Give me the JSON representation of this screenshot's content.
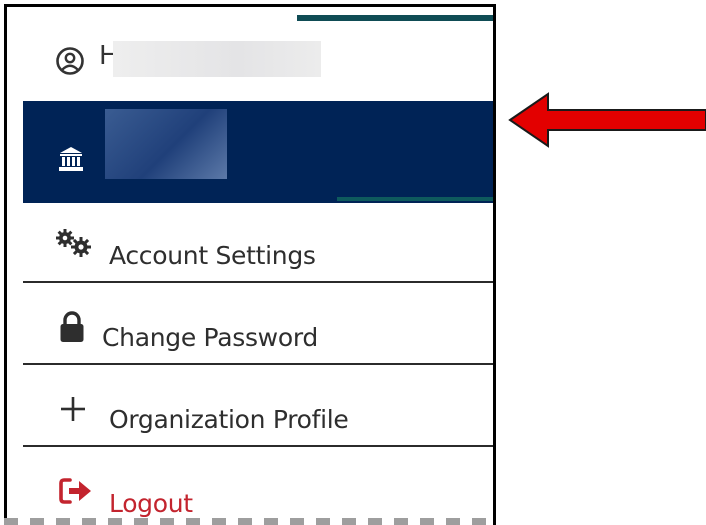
{
  "menu": {
    "user_initial": "H",
    "account_settings_label": "Account Settings",
    "change_password_label": "Change Password",
    "organization_profile_label": "Organization Profile",
    "logout_label": "Logout"
  },
  "icons": {
    "user": "user-circle-icon",
    "organization": "bank-icon",
    "settings": "gears-icon",
    "password": "lock-icon",
    "profile": "plus-icon",
    "logout": "sign-out-icon",
    "annotation": "red-arrow-icon"
  },
  "colors": {
    "selected_row": "#002356",
    "logout": "#c3242e",
    "arrow": "#e30000"
  }
}
